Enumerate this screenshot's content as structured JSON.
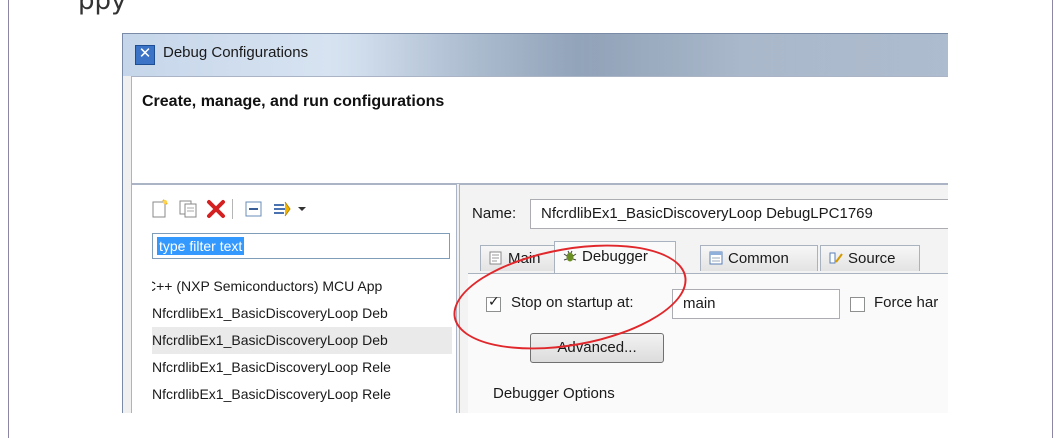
{
  "document": {
    "top_text": "ppy"
  },
  "window": {
    "title": "Debug Configurations",
    "app_icon": "eclipse-debug-icon",
    "header_title": "Create, manage, and run configurations"
  },
  "left_pane": {
    "toolbar_icons": [
      "new-config-icon",
      "duplicate-icon",
      "delete-icon",
      "collapse-all-icon",
      "filter-icon",
      "dropdown-arrow-icon"
    ],
    "filter_placeholder": "type filter text",
    "tree_items": [
      "C++ (NXP Semiconductors) MCU App",
      "NfcrdlibEx1_BasicDiscoveryLoop Deb",
      "NfcrdlibEx1_BasicDiscoveryLoop Deb",
      "NfcrdlibEx1_BasicDiscoveryLoop Rele",
      "NfcrdlibEx1_BasicDiscoveryLoop Rele"
    ]
  },
  "right_pane": {
    "name_label": "Name:",
    "name_value": "NfcrdlibEx1_BasicDiscoveryLoop DebugLPC1769",
    "tabs": [
      {
        "label": "Main",
        "icon": "main-tab-icon"
      },
      {
        "label": "Debugger",
        "icon": "debugger-bug-icon"
      },
      {
        "label": "Common",
        "icon": "common-tab-icon"
      },
      {
        "label": "Source",
        "icon": "source-tab-icon"
      }
    ],
    "stop_on_startup_label": "Stop on startup at:",
    "stop_on_startup_checked": true,
    "stop_on_startup_value": "main",
    "force_label": "Force har",
    "force_checked": false,
    "advanced_button": "Advanced...",
    "debugger_options_heading": "Debugger Options"
  },
  "colors": {
    "highlight_circle": "#e0272b",
    "selection": "#3399ff"
  }
}
